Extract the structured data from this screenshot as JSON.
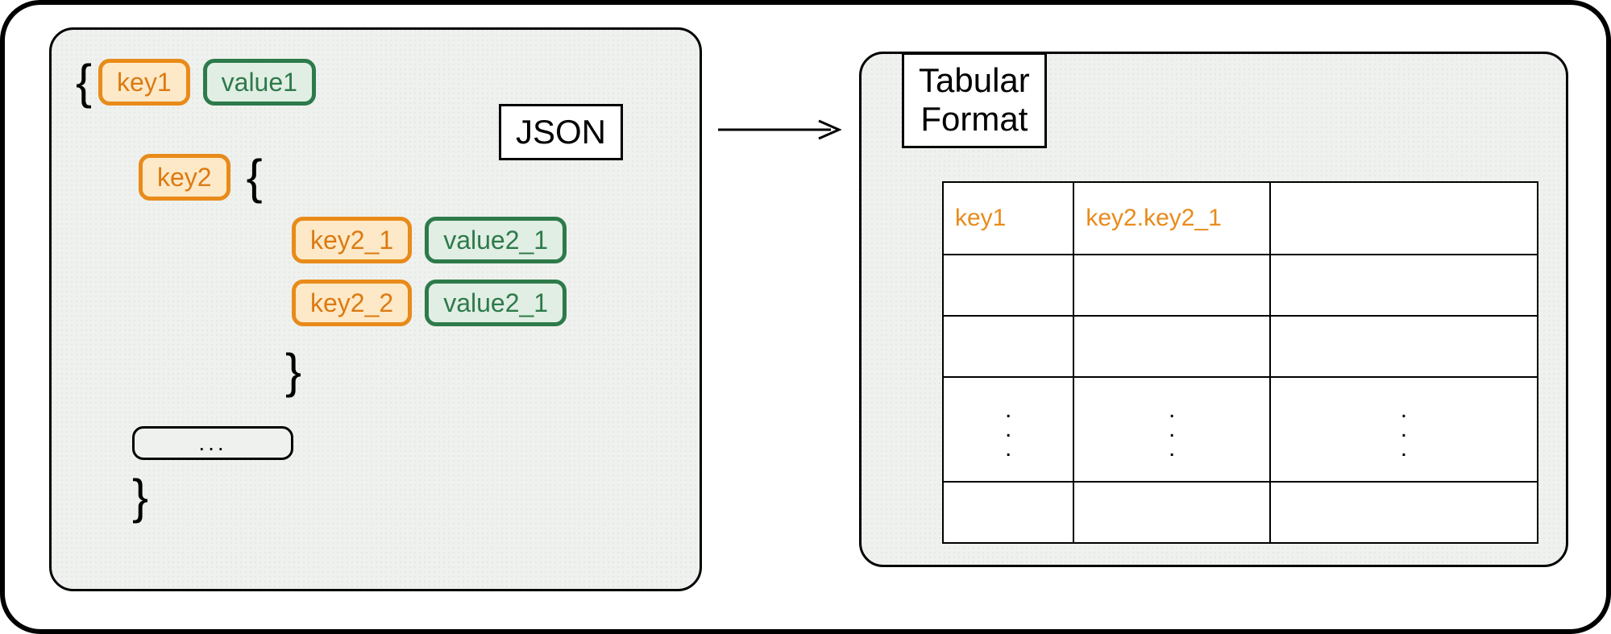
{
  "colors": {
    "key_fill": "#fde9c7",
    "key_border": "#e88b1a",
    "key_text": "#dc7a12",
    "val_fill": "#e1eee4",
    "val_border": "#2d7a4a",
    "val_text": "#2d7a4a",
    "panel_bg": "#eef1ee"
  },
  "left_panel": {
    "title": "JSON",
    "open_brace": "{",
    "close_brace": "}",
    "row1": {
      "key": "key1",
      "value": "value1"
    },
    "row2": {
      "key": "key2",
      "open_brace": "{",
      "close_brace": "}",
      "children": [
        {
          "key": "key2_1",
          "value": "value2_1"
        },
        {
          "key": "key2_2",
          "value": "value2_1"
        }
      ]
    },
    "ellipsis": "..."
  },
  "arrow": {
    "direction": "right"
  },
  "right_panel": {
    "title_line1": "Tabular",
    "title_line2": "Format",
    "table": {
      "headers": [
        "key1",
        "key2.key2_1",
        ""
      ],
      "body_rows_blank": 2,
      "vdots_row": true,
      "footer_row_blank": true
    }
  }
}
